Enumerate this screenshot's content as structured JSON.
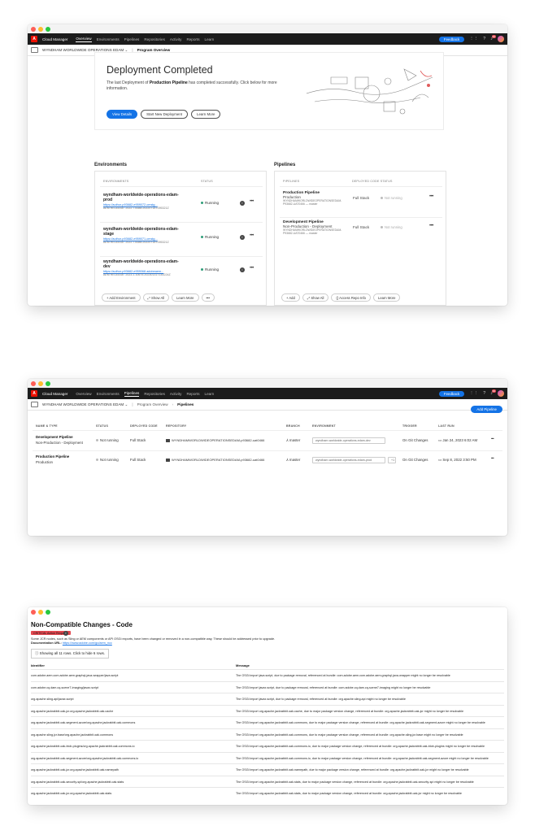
{
  "app": {
    "name": "Cloud Manager",
    "nav": [
      "Overview",
      "Environments",
      "Pipelines",
      "Repositories",
      "Activity",
      "Reports",
      "Learn"
    ],
    "feedback": "Feedback",
    "notif_count": "99",
    "program": "WYNDHAM WORLDWIDE OPERATIONS EDAM"
  },
  "shot1": {
    "crumb": "Program Overview",
    "hero": {
      "title": "Deployment Completed",
      "text_pre": "The last Deployment of ",
      "text_bold": "Production Pipeline",
      "text_post": " has completed successfully. Click below for more information.",
      "btn_view": "View Details",
      "btn_start": "Start New Deployment",
      "btn_learn": "Learn More"
    },
    "environments": {
      "title": "Environments",
      "col_env": "ENVIRONMENTS",
      "col_status": "STATUS",
      "rows": [
        {
          "name1": "wyndham-worldwide-operations-edam-",
          "name2": "prod",
          "link": "https://author-p93682-e959072-cmstg...",
          "release": "AEM RELEASE: 2022.7.8388.20220718T095321Z",
          "status": "Running"
        },
        {
          "name1": "wyndham-worldwide-operations-edam-",
          "name2": "stage",
          "link": "https://author-p93682-e959071-cmstg...",
          "release": "AEM RELEASE: 2022.7.8388.20220718T095321Z",
          "status": "Running"
        },
        {
          "name1": "wyndham-worldwide-operations-edam-",
          "name2": "dev",
          "link": "https://author-p93682-e959068.adobeaem...",
          "release": "AEM RELEASE: 2023.1.10675.20230131T144224Z",
          "status": "Running"
        }
      ],
      "add": "Add Environment",
      "show_all": "Show All",
      "learn": "Learn More"
    },
    "pipelines": {
      "title": "Pipelines",
      "col_pipe": "PIPELINES",
      "col_status": "DEPLOYED CODE STATUS",
      "rows": [
        {
          "name": "Production Pipeline",
          "type": "Production",
          "repo": "WYNDHAMWORLDWIDEOPERATIONSEDAM-",
          "branch": "P93682-UAT0466 — master",
          "code": "Full Stack",
          "status": "Not running"
        },
        {
          "name": "Development Pipeline",
          "type": "Non-Production - Deployment",
          "repo": "WYNDHAMWORLDWIDEOPERATIONSEDAM-",
          "branch": "P93682-UAT0466 — master",
          "code": "Full Stack",
          "status": "Not running"
        }
      ],
      "add": "Add",
      "show_all": "Show All",
      "access": "Access Repo Info",
      "learn": "Learn More"
    }
  },
  "shot2": {
    "crumb_link": "Program Overview",
    "crumb_current": "Pipelines",
    "add_btn": "Add Pipeline",
    "headers": [
      "NAME & TYPE",
      "STATUS",
      "DEPLOYED CODE",
      "REPOSITORY",
      "BRANCH",
      "ENVIRONMENT",
      "TRIGGER",
      "LAST RUN"
    ],
    "rows": [
      {
        "name": "Development Pipeline",
        "type": "Non-Production - Deployment",
        "status": "Not running",
        "code": "Full Stack",
        "repo": "WYNDHAMWORLDWIDEOPERATIONSEDAM-p93682-uat0466",
        "branch": "master",
        "env": "wyndham-worldwide-operations-edam-dev",
        "trigger": "On Git Changes",
        "last": "Jan 24, 2023 6:02 AM"
      },
      {
        "name": "Production Pipeline",
        "type": "Production",
        "status": "Not running",
        "code": "Full Stack",
        "repo": "WYNDHAMWORLDWIDEOPERATIONSEDAM-p93682-uat0466",
        "branch": "master",
        "env": "wyndham-worldwide-operations-edam-prod",
        "trigger": "On Git Changes",
        "last": "Sep 8, 2022 3:50 PM"
      }
    ]
  },
  "shot3": {
    "title": "Non-Compatible Changes - Code",
    "badge": "CRITICAL Action Required",
    "desc": "Some JCR nodes, such as Sling or AEM components or API OSGi exports, have been changed or removed in a non-compatible way. These should be addressed prior to upgrade.",
    "doc_label": "Documentation URL: ",
    "doc_url": "https://www.adobe.com/go/aem_ncc",
    "show_all": "Showing all 11 rows. Click to hide 6 rows.",
    "col_id": "Identifier",
    "col_msg": "Message",
    "rows": [
      {
        "id": "com.adobe.aem.com.adobe.aem.graphql-java-wrapper/java.script",
        "msg": "The OSGi import java.script, due to package removal, referenced at bundle: com.adobe.aem.com.adobe.aem.graphql-java-wrapper might no longer be resolvable"
      },
      {
        "id": "com.adobe.cq.dam.cq-scene7-imaging/javax.script",
        "msg": "The OSGi import javax.script, due to package removal, referenced at bundle: com.adobe.cq.dam.cq-scene7-imaging might no longer be resolvable"
      },
      {
        "id": "org.apache.sling.api/javax.script",
        "msg": "The OSGi import javax.script, due to package removal, referenced at bundle: org.apache.sling.api might no longer be resolvable"
      },
      {
        "id": "org.apache.jackrabbit.oak-jcr.org.apache.jackrabbit.oak.cache",
        "msg": "The OSGi import org.apache.jackrabbit.oak.cache, due to major package version change, referenced at bundle: org.apache.jackrabbit.oak-jcr might no longer be resolvable"
      },
      {
        "id": "org.apache.jackrabbit.oak-segment-azure/org.apache.jackrabbit.oak.commons",
        "msg": "The OSGi import org.apache.jackrabbit.oak.commons, due to major package version change, referenced at bundle: org.apache.jackrabbit.oak-segment-azure might no longer be resolvable"
      },
      {
        "id": "org.apache.sling.jcr.base/org.apache.jackrabbit.oak.commons",
        "msg": "The OSGi import org.apache.jackrabbit.oak.commons, due to major package version change, referenced at bundle: org.apache.sling.jcr.base might no longer be resolvable"
      },
      {
        "id": "org.apache.jackrabbit.oak-blob-plugins/org.apache.jackrabbit.oak.commons.io",
        "msg": "The OSGi import org.apache.jackrabbit.oak.commons.io, due to major package version change, referenced at bundle: org.apache.jackrabbit.oak-blob-plugins might no longer be resolvable"
      },
      {
        "id": "org.apache.jackrabbit.oak-segment-azure/org.apache.jackrabbit.oak.commons.io",
        "msg": "The OSGi import org.apache.jackrabbit.oak.commons.io, due to major package version change, referenced at bundle: org.apache.jackrabbit.oak-segment-azure might no longer be resolvable"
      },
      {
        "id": "org.apache.jackrabbit.oak-jcr.org.apache.jackrabbit.oak.namepath",
        "msg": "The OSGi import org.apache.jackrabbit.oak.namepath, due to major package version change, referenced at bundle: org.apache.jackrabbit.oak-jcr might no longer be resolvable"
      },
      {
        "id": "org.apache.jackrabbit.oak-security-spi/org.apache.jackrabbit.oak.stats",
        "msg": "The OSGi import org.apache.jackrabbit.oak.stats, due to major package version change, referenced at bundle: org.apache.jackrabbit.oak-security-spi might no longer be resolvable"
      },
      {
        "id": "org.apache.jackrabbit.oak-jcr.org.apache.jackrabbit.oak.stats",
        "msg": "The OSGi import org.apache.jackrabbit.oak.stats, due to major package version change, referenced at bundle: org.apache.jackrabbit.oak-jcr might no longer be resolvable"
      }
    ]
  }
}
